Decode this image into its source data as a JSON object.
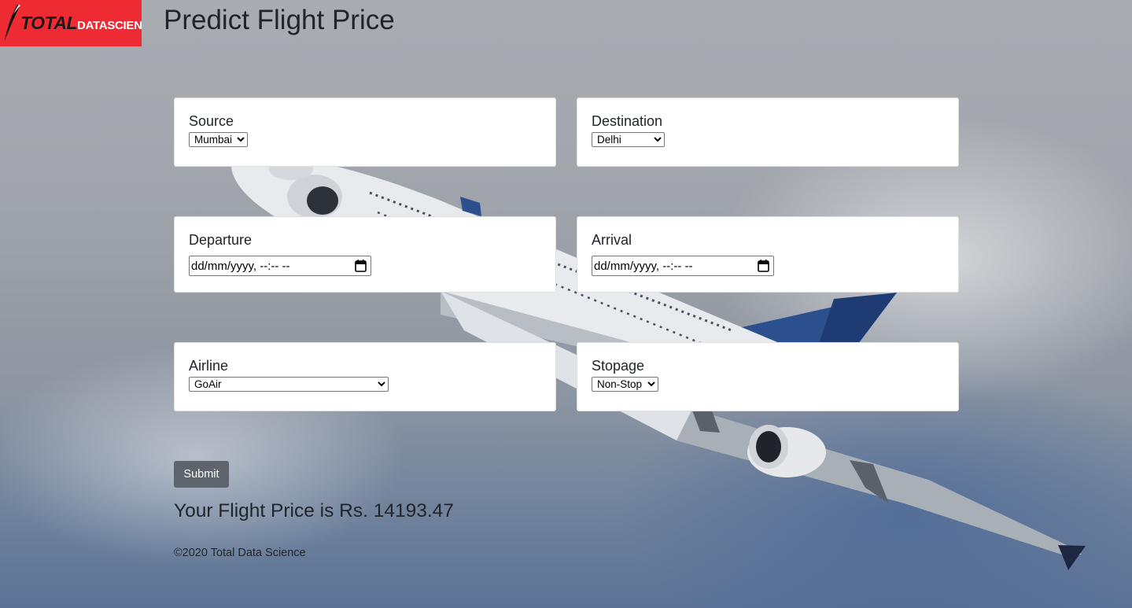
{
  "header": {
    "logo_total": "TOTAL",
    "logo_ds": "DATASCIENCE",
    "title": "Predict Flight Price"
  },
  "form": {
    "source": {
      "label": "Source",
      "value": "Mumbai"
    },
    "destination": {
      "label": "Destination",
      "value": "Delhi"
    },
    "departure": {
      "label": "Departure",
      "placeholder": "dd/mm/yyyy, --:-- --"
    },
    "arrival": {
      "label": "Arrival",
      "placeholder": "dd/mm/yyyy, --:-- --"
    },
    "airline": {
      "label": "Airline",
      "value": "GoAir"
    },
    "stopage": {
      "label": "Stopage",
      "value": "Non-Stop"
    },
    "submit_label": "Submit"
  },
  "result_text": "Your Flight Price is Rs. 14193.47",
  "footer_text": "©2020 Total Data Science",
  "colors": {
    "logo_bg": "#ee2a33",
    "submit_bg": "#5d646b",
    "card_bg": "#ffffff"
  },
  "icons": {
    "calendar": "calendar-icon",
    "logo_mark": "swoosh-icon"
  }
}
